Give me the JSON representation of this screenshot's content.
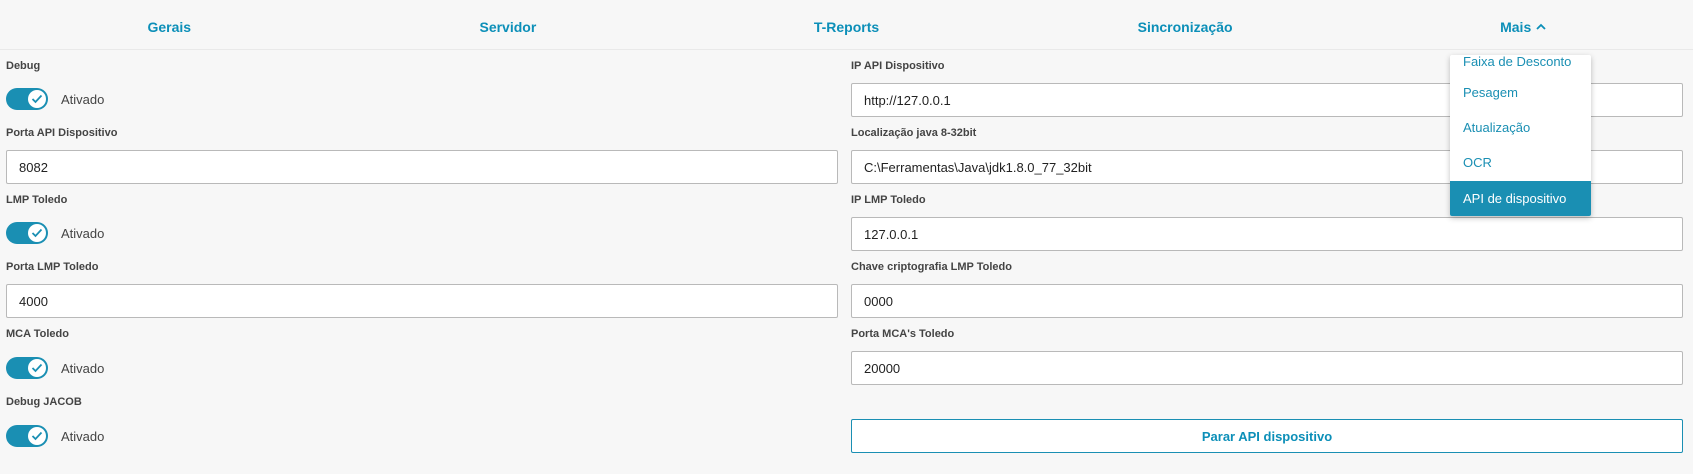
{
  "tabs": [
    "Gerais",
    "Servidor",
    "T-Reports",
    "Sincronização",
    "Mais"
  ],
  "left": {
    "debug": {
      "label": "Debug",
      "toggle_text": "Ativado"
    },
    "porta_api": {
      "label": "Porta API Dispositivo",
      "value": "8082"
    },
    "lmp_toledo": {
      "label": "LMP Toledo",
      "toggle_text": "Ativado"
    },
    "porta_lmp": {
      "label": "Porta LMP Toledo",
      "value": "4000"
    },
    "mca_toledo": {
      "label": "MCA Toledo",
      "toggle_text": "Ativado"
    },
    "debug_jacob": {
      "label": "Debug JACOB",
      "toggle_text": "Ativado"
    }
  },
  "right": {
    "ip_api": {
      "label": "IP API Dispositivo",
      "value": "http://127.0.0.1"
    },
    "java_loc": {
      "label": "Localização java 8-32bit",
      "value": "C:\\Ferramentas\\Java\\jdk1.8.0_77_32bit"
    },
    "ip_lmp": {
      "label": "IP LMP Toledo",
      "value": "127.0.0.1"
    },
    "chave_lmp": {
      "label": "Chave criptografia LMP Toledo",
      "value": "0000"
    },
    "porta_mca": {
      "label": "Porta MCA's Toledo",
      "value": "20000"
    },
    "stop_button": "Parar API dispositivo"
  },
  "dropdown": {
    "items": [
      "Faixa de Desconto",
      "Pesagem",
      "Atualização",
      "OCR",
      "API de dispositivo"
    ],
    "active_index": 4
  },
  "colors": {
    "accent": "#1a8fb3",
    "background": "#f7f7f7"
  }
}
